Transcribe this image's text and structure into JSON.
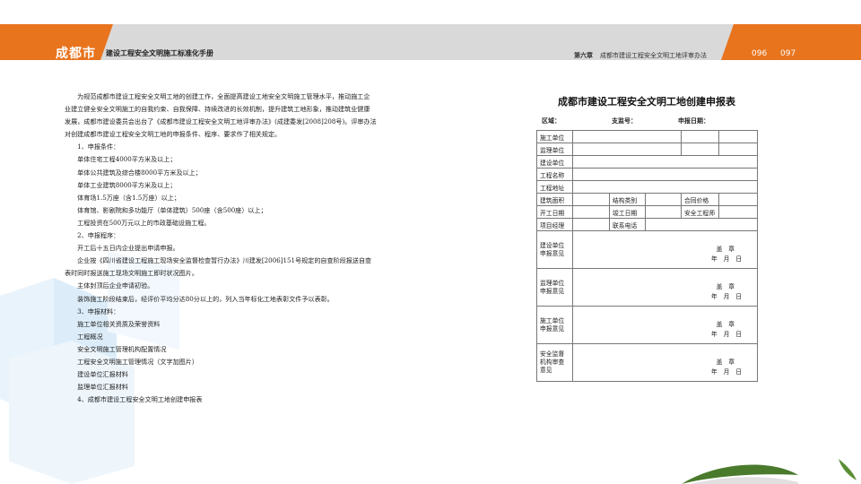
{
  "header": {
    "brand": "成都市",
    "handbook_title": "建设工程安全文明施工标准化手册",
    "chapter_label": "第六章",
    "chapter_title": "成都市建设工程安全文明工地评审办法",
    "page_left": "096",
    "page_right": "097"
  },
  "body_paragraphs": [
    "　　为规范成都市建设工程安全文明工地的创建工作，全面提高建设工地安全文明施工管理水平，推动施工企",
    "业建立健全安全文明施工的自我约束、自我保障、持续改进的长效机制，提升建筑工地形象，推动建筑业健康",
    "发展，成都市建设委员会出台了《成都市建设工程安全文明工地评审办法》(成建委发[2008]208号)。评审办法",
    "对创建成都市建设工程安全文明工地的申报条件、程序、要求作了相关规定。",
    "　　1、申报条件：",
    "　　单体住宅工程4000平方米及以上；",
    "　　单体公共建筑及综合楼8000平方米及以上；",
    "　　单体工业建筑8000平方米及以上；",
    "　　体育场1.5万座（含1.5万座）以上；",
    "　　体育馆、影剧院和多功能厅（单体建筑）500座（含500座）以上；",
    "　　工程投资在500万元以上的市政基础设施工程。",
    "　　2、申报程序：",
    "　　开工后十五日内企业提出申请申报。",
    "　　企业按《四川省建设工程施工现场安全监督检查暂行办法》川建发[2006]151号规定的自查阶段报送自查",
    "表时同时报送施工现场文明施工即时状况图片。",
    "　　主体封顶后企业申请初验。",
    "　　装饰施工阶段结束后，经评价平均分达80分以上的，列入当年标化工地表彰文件予以表彰。",
    "　　3、申报材料：",
    "　　施工单位相关资质及荣誉资料",
    "　　工程概况",
    "　　安全文明施工管理机构配置情况",
    "　　工程安全文明施工管理情况（文字加图片）",
    "　　建设单位汇报材料",
    "　　监理单位汇报材料",
    "　　4、成都市建设工程安全文明工地创建申报表"
  ],
  "form": {
    "title": "成都市建设工程安全文明工地创建申报表",
    "region_label": "区域：",
    "station_label": "支监号：",
    "date_label": "申报日期：",
    "rows": {
      "construction_unit": "施工单位",
      "supervision_unit": "监理单位",
      "owner_unit": "建设单位",
      "project_name": "工程名称",
      "project_address": "工程地址",
      "building_area": "建筑面积",
      "structure_type": "结构类别",
      "contract_price": "合同价格",
      "start_date": "开工日期",
      "finish_date": "竣工日期",
      "safety_engineer": "安全工程师",
      "project_manager": "项目经理",
      "contact_phone": "联系电话"
    },
    "opinions": [
      {
        "label": "建设单位申报意见"
      },
      {
        "label": "监理单位申报意见"
      },
      {
        "label": "施工单位申报意见"
      },
      {
        "label": "安全监督机构审查意见"
      }
    ],
    "stamp_text": "盖　章",
    "date_text": "年　月　日"
  },
  "colors": {
    "accent": "#e8741e",
    "header_gray": "#d9d9d9"
  }
}
